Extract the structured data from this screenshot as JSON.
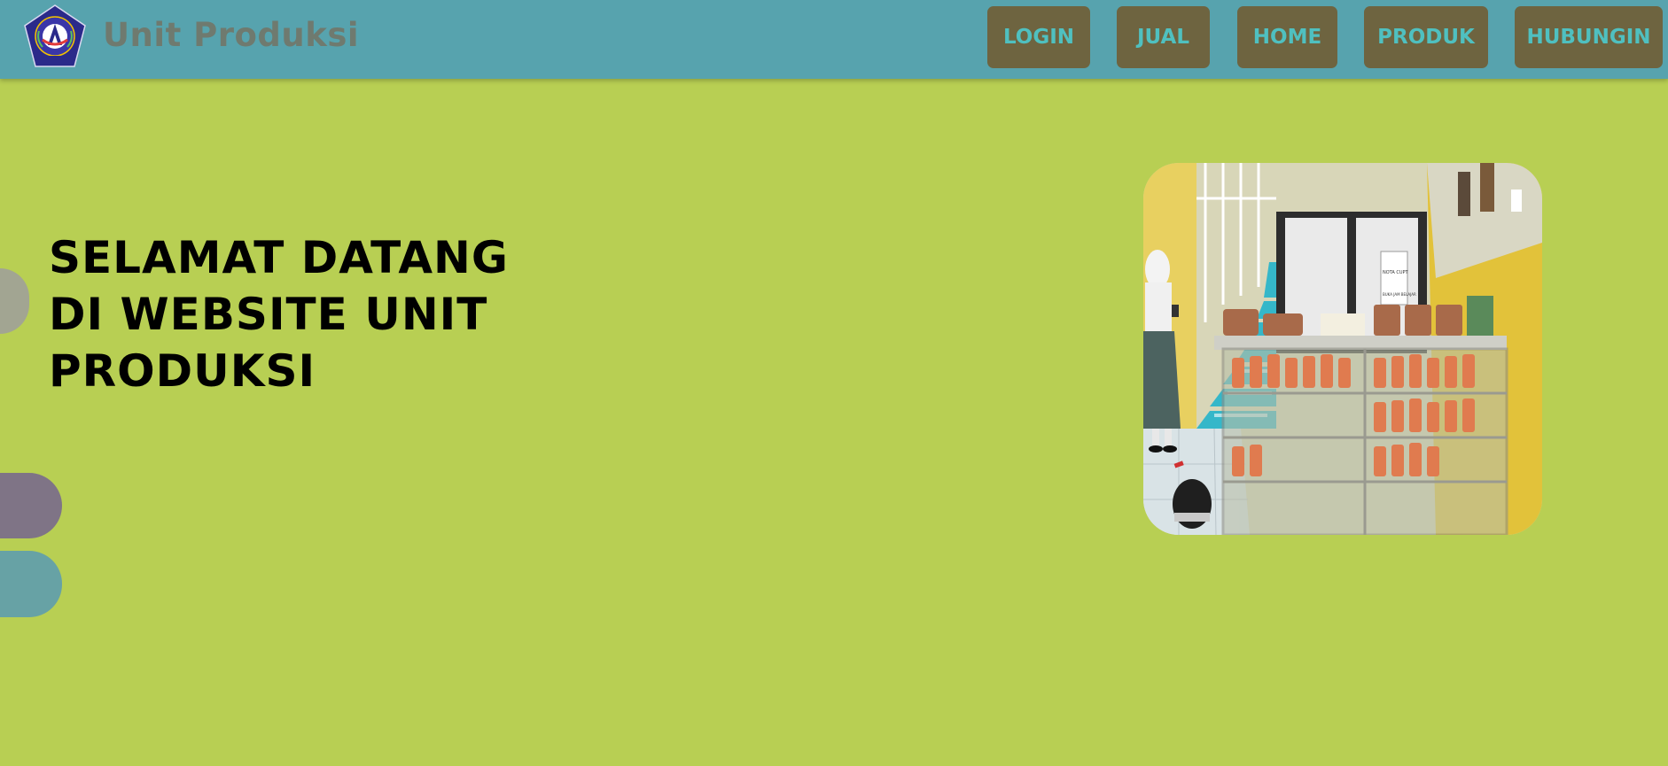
{
  "header": {
    "brand": "Unit Produksi",
    "logo": {
      "text_top": "YAYASAN ABDI KARYA",
      "text_bottom": "JAKARTA",
      "letter": "A",
      "ribbon": "SEJUTA"
    },
    "nav": [
      "LOGIN",
      "JUAL",
      "HOME",
      "PRODUK",
      "HUBUNGIN"
    ]
  },
  "hero": {
    "title": "SELAMAT DATANG DI WEBSITE UNIT PRODUKSI"
  },
  "photo": {
    "panel_labels": [
      "NOTA CUPT",
      "BUKA JAM BELAJAR"
    ]
  },
  "colors": {
    "page_bg": "#b8cf53",
    "header_bg": "#57a3ae",
    "nav_bg": "#6e6440",
    "nav_text": "#4fc0c0",
    "brand_text": "#6f7a6f",
    "deco_gray": "#a2a592",
    "deco_purple": "#7f7486",
    "deco_teal": "#67a2a5"
  }
}
